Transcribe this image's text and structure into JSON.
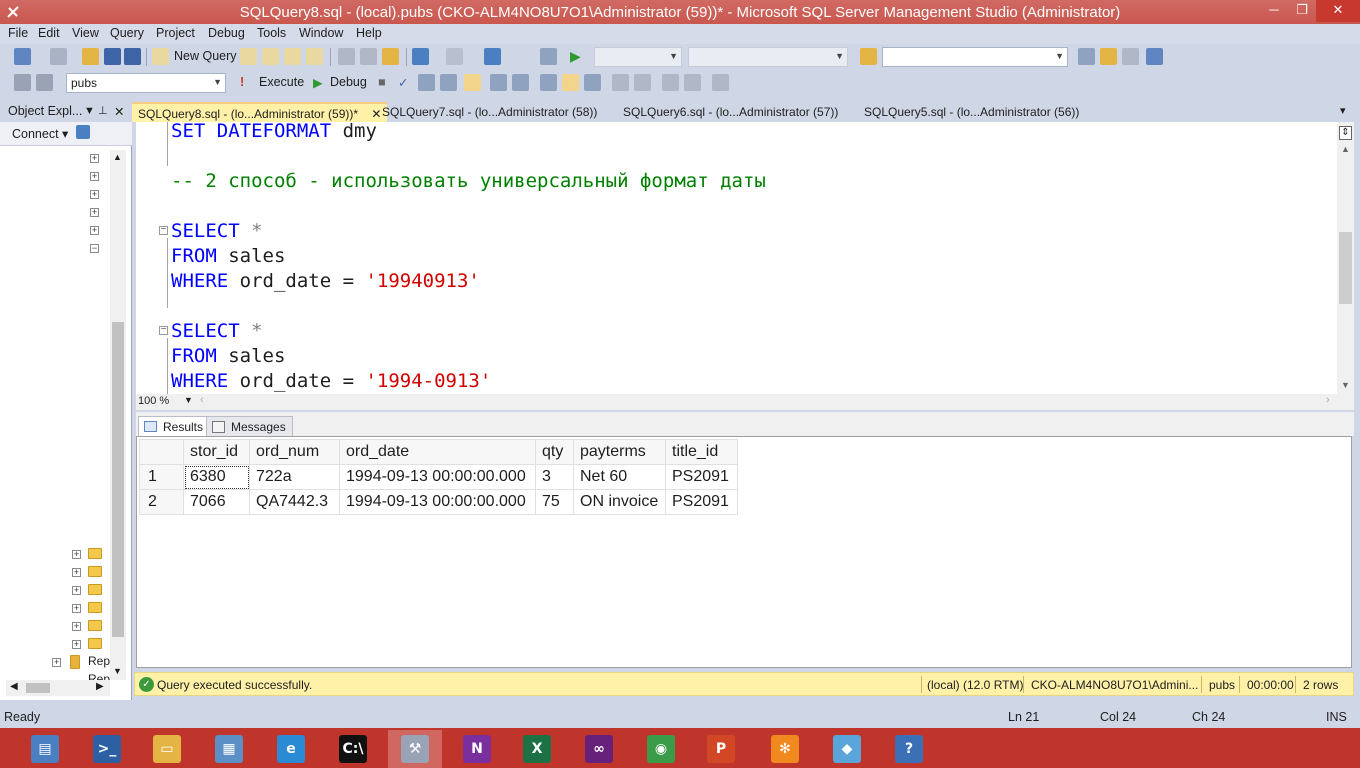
{
  "window": {
    "title": "SQLQuery8.sql - (local).pubs (CKO-ALM4NO8U7O1\\Administrator (59))* - Microsoft SQL Server Management Studio (Administrator)",
    "min": "─",
    "max": "❐",
    "close": "✕"
  },
  "menu": [
    "File",
    "Edit",
    "View",
    "Query",
    "Project",
    "Debug",
    "Tools",
    "Window",
    "Help"
  ],
  "toolbar1": {
    "new_query": "New Query"
  },
  "toolbar2": {
    "database": "pubs",
    "execute": "Execute",
    "debug": "Debug"
  },
  "object_explorer": {
    "title": "Object Expl...",
    "pin": "▼ ⊥",
    "close": "✕",
    "connect": "Connect ▾",
    "items": [
      "Rep",
      "Rep"
    ]
  },
  "tabs": [
    {
      "label": "SQLQuery8.sql - (lo...Administrator (59))*",
      "close": "✕"
    },
    {
      "label": "SQLQuery7.sql - (lo...Administrator (58))"
    },
    {
      "label": "SQLQuery6.sql - (lo...Administrator (57))"
    },
    {
      "label": "SQLQuery5.sql - (lo...Administrator (56))"
    }
  ],
  "editor": {
    "line1": {
      "kw": "SET DATEFORMAT",
      "rest": " dmy"
    },
    "comment": "-- 2 способ - использовать универсальный формат даты",
    "q1": {
      "select": "SELECT",
      "star": " *",
      "from": "FROM",
      "table": " sales",
      "where": "WHERE",
      "cond": " ord_date = ",
      "value": "'19940913'"
    },
    "q2": {
      "select": "SELECT",
      "star": " *",
      "from": "FROM",
      "table": " sales",
      "where": "WHERE",
      "cond": " ord_date = ",
      "value": "'1994-0913'"
    },
    "zoom": "100 %"
  },
  "results": {
    "tab_results": "Results",
    "tab_messages": "Messages",
    "columns": [
      "stor_id",
      "ord_num",
      "ord_date",
      "qty",
      "payterms",
      "title_id"
    ],
    "rows": [
      {
        "n": "1",
        "cells": [
          "6380",
          "722a",
          "1994-09-13 00:00:00.000",
          "3",
          "Net 60",
          "PS2091"
        ]
      },
      {
        "n": "2",
        "cells": [
          "7066",
          "QA7442.3",
          "1994-09-13 00:00:00.000",
          "75",
          "ON invoice",
          "PS2091"
        ]
      }
    ]
  },
  "query_status": {
    "message": "Query executed successfully.",
    "server": "(local) (12.0 RTM)",
    "user": "CKO-ALM4NO8U7O1\\Admini...",
    "db": "pubs",
    "time": "00:00:00",
    "rows": "2 rows"
  },
  "status": {
    "ready": "Ready",
    "ln": "Ln 21",
    "col": "Col 24",
    "ch": "Ch 24",
    "ins": "INS"
  },
  "taskbar": [
    {
      "name": "server-manager-icon",
      "glyph": "▤",
      "color": "#4a7fc1"
    },
    {
      "name": "powershell-icon",
      "glyph": ">_",
      "color": "#2d5fa3"
    },
    {
      "name": "file-explorer-icon",
      "glyph": "▭",
      "color": "#e4b445"
    },
    {
      "name": "control-panel-icon",
      "glyph": "▦",
      "color": "#5b8fc6"
    },
    {
      "name": "internet-explorer-icon",
      "glyph": "e",
      "color": "#2a8ad4"
    },
    {
      "name": "command-prompt-icon",
      "glyph": "C:\\",
      "color": "#111111"
    },
    {
      "name": "ssms-icon",
      "glyph": "⚒",
      "color": "#9aa3b5"
    },
    {
      "name": "onenote-icon",
      "glyph": "N",
      "color": "#7b2f9e"
    },
    {
      "name": "excel-icon",
      "glyph": "X",
      "color": "#1e7145"
    },
    {
      "name": "visual-studio-icon",
      "glyph": "∞",
      "color": "#68217a"
    },
    {
      "name": "chrome-icon",
      "glyph": "◉",
      "color": "#3a9b48"
    },
    {
      "name": "powerpoint-icon",
      "glyph": "P",
      "color": "#d24726"
    },
    {
      "name": "snowflake-app-icon",
      "glyph": "✻",
      "color": "#f08a1f"
    },
    {
      "name": "blue-app-icon",
      "glyph": "◆",
      "color": "#5aa5d9"
    },
    {
      "name": "help-viewer-icon",
      "glyph": "?",
      "color": "#3b6fb6"
    }
  ]
}
